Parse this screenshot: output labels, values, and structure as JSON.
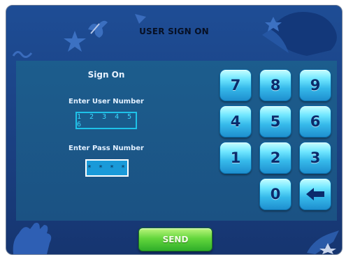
{
  "header": {
    "title": "USER SIGN ON"
  },
  "form": {
    "heading": "Sign On",
    "user_label": "Enter User Number",
    "user_value": "1 2 3 4 5 6",
    "pass_label": "Enter Pass Number",
    "pass_value": "* * * *"
  },
  "keypad": {
    "keys": [
      "7",
      "8",
      "9",
      "4",
      "5",
      "6",
      "1",
      "2",
      "3",
      "0"
    ],
    "back_icon": "left-arrow-icon"
  },
  "actions": {
    "send_label": "SEND"
  },
  "colors": {
    "background": "#1e4d95",
    "panel": "#1c5d8d",
    "key": "#36b9ea",
    "send": "#63d63c"
  }
}
